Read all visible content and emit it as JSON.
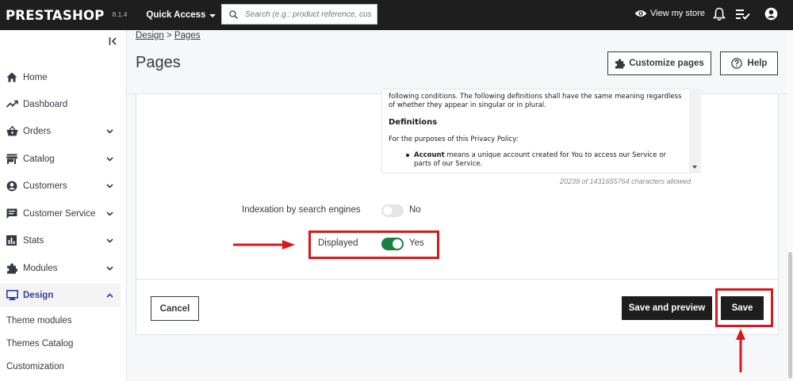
{
  "topbar": {
    "logo": "PRESTASHOP",
    "version": "8.1.4",
    "quick_access": "Quick Access",
    "search_placeholder": "Search (e.g.: product reference, custon",
    "view_store": "View my store"
  },
  "sidebar": {
    "items": [
      {
        "label": "Home",
        "icon": "home-icon"
      },
      {
        "label": "Dashboard",
        "icon": "trending-up-icon"
      },
      {
        "label": "Orders",
        "icon": "shopping-basket-icon"
      },
      {
        "label": "Catalog",
        "icon": "store-icon"
      },
      {
        "label": "Customers",
        "icon": "account-circle-icon"
      },
      {
        "label": "Customer Service",
        "icon": "chat-icon"
      },
      {
        "label": "Stats",
        "icon": "bar-chart-icon"
      },
      {
        "label": "Modules",
        "icon": "puzzle-icon"
      },
      {
        "label": "Design",
        "icon": "desktop-icon"
      }
    ],
    "design_subitems": [
      "Theme modules",
      "Themes Catalog",
      "Customization"
    ]
  },
  "header": {
    "breadcrumb_1": "Design",
    "breadcrumb_sep": " > ",
    "breadcrumb_2": "Pages",
    "title": "Pages",
    "customize_label": "Customize pages",
    "help_label": "Help"
  },
  "editor": {
    "text_1": "following conditions. The following definitions shall have the same meaning regardless of whether they appear in singular or in plural.",
    "heading": "Definitions",
    "text_2": "For the purposes of this Privacy Policy:",
    "list_item_bold": "Account",
    "list_item_rest": " means a unique account created for You to access our Service or parts of our Service.",
    "char_count": "20239 of 1431655764 characters allowed"
  },
  "form": {
    "indexation_label": "Indexation by search engines",
    "indexation_value": "No",
    "displayed_label": "Displayed",
    "displayed_value": "Yes"
  },
  "footer": {
    "cancel_label": "Cancel",
    "save_preview_label": "Save and preview",
    "save_label": "Save"
  },
  "colors": {
    "topbar": "#1e1e1e",
    "toggle_on": "#1b7e3e",
    "annotation_red": "#d9171e",
    "active_nav": "#2f3fa0"
  }
}
